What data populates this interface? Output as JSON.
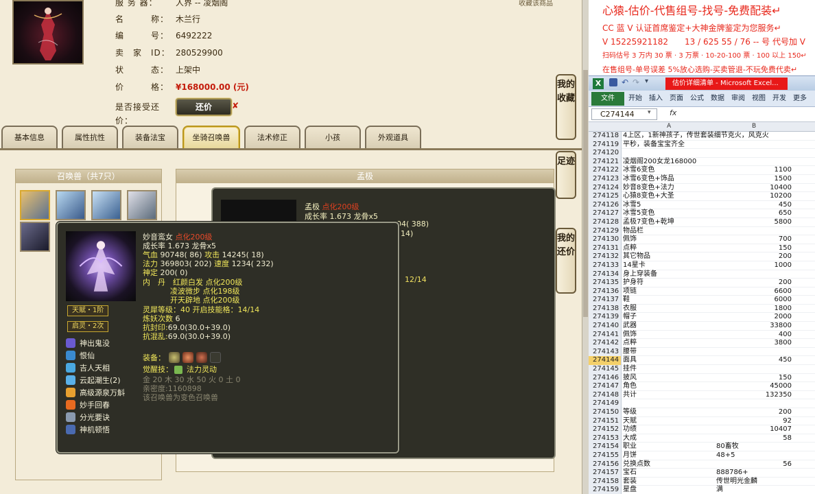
{
  "listing": {
    "server_label": "服 务 器：",
    "server_value": "人界 -- 凌烟阁",
    "name_label": "名　　　称：",
    "name_value": "木兰行",
    "id_label": "编　　　号：",
    "id_value": "6492222",
    "seller_label": "卖　家　ID：",
    "seller_value": "280529900",
    "status_label": "状　　　态：",
    "status_value": "上架中",
    "price_label": "价　　　格：",
    "price_value": "¥168000.00 (元)",
    "counter_label": "是否接受还价：",
    "counter_button": "还价",
    "counter_mark": "✘",
    "fav_link": "收藏该商品"
  },
  "tabs": [
    "基本信息",
    "属性抗性",
    "装备法宝",
    "坐骑召唤兽",
    "法术修正",
    "小孩",
    "外观道具"
  ],
  "active_tab": "坐骑召唤兽",
  "side_buttons": [
    {
      "label": "我的收藏"
    },
    {
      "label": "足迹"
    },
    {
      "label": "我的还价"
    }
  ],
  "pets_panel": {
    "title": "召唤兽（共7只）"
  },
  "detail_panel": {
    "title": "孟极"
  },
  "back_tooltip": {
    "name": "孟极",
    "tag": "点化200级",
    "growth": "成长率 1.673 龙骨x5",
    "frag1": "04( 388)",
    "frag2": "14)",
    "frag3": "12/14"
  },
  "tooltip": {
    "name": "妙音鸾女",
    "tag": "点化200级",
    "growth": "成长率 1.673 龙骨x5",
    "hp_label": "气血",
    "hp": "90748( 86)",
    "atk_label": "攻击",
    "atk": "14245( 18)",
    "mp_label": "法力",
    "mp": "369803( 202)",
    "spd_label": "速度",
    "spd": "1234( 232)",
    "def_label": "神定",
    "def": "200( 0)",
    "neidan_label": "内　丹",
    "neidan1": "红颜白发 点化200级",
    "neidan2": "凌波微步 点化198级",
    "neidan3": "开天辟地 点化200级",
    "talent_badge": "天赋・1阶",
    "qiling_badge": "启灵・2次",
    "lingxi_label": "灵犀等级：",
    "lingxi_value": "40 开启技能格：14/14",
    "refine_label": "炼妖次数",
    "refine_value": "6",
    "resist_seal_label": "抗封印:",
    "resist_seal_value": "69.0(30.0+39.0)",
    "resist_chaos_label": "抗混乱:",
    "resist_chaos_value": "69.0(30.0+39.0)",
    "equip_label": "装备：",
    "awaken_label": "觉醒技：",
    "awaken_value": "法力灵动",
    "elements": "金 20 木 30 水 50 火 0 土 0",
    "intimacy": "亲密度:1160898",
    "note": "该召唤兽为变色召唤兽",
    "skills": [
      "神出鬼没",
      "恨仙",
      "吉人天相",
      "云起潮生(2)",
      "高级源泉万斛",
      "妙手回春",
      "分光要诀",
      "神机顿悟"
    ]
  },
  "ad": {
    "line1": "心猿-估价-代售组号-找号-免费配装↵",
    "line2": "CC 蓝 V 认证首席鉴定+大神金牌鉴定为您服务↵",
    "line3": "V 15225921182　　13 / 625 55 / 76 -- 号 代号加 V",
    "line4": "扫码估号 3 万内 30 票 · 3 万票 · 10-20-100 票 · 100 以上 150↵",
    "line5": "在售组号-单号误差 5%放心选购-买卖管退-不玩免费代卖↵"
  },
  "excel": {
    "title": "估价详细清单 - Microsoft Excel...",
    "ribbon_tabs": [
      "文件",
      "开始",
      "插入",
      "页面",
      "公式",
      "数据",
      "审阅",
      "视图",
      "开发",
      "更多"
    ],
    "namebox": "C274144",
    "fx": "fx",
    "col_a": "A",
    "col_b": "B",
    "rows": [
      {
        "n": "274118",
        "a": "4上区，1新神孩子，传世套装细节克火，风克火",
        "b": ""
      },
      {
        "n": "274119",
        "a": "平秒，装备宝宝齐全",
        "b": ""
      },
      {
        "n": "274120",
        "a": "",
        "b": ""
      },
      {
        "n": "274121",
        "a": "凌烟阁200女龙168000",
        "b": ""
      },
      {
        "n": "274122",
        "a": "冰雪6变色",
        "b": "1100"
      },
      {
        "n": "274123",
        "a": "冰雪6变色+饰品",
        "b": "1500"
      },
      {
        "n": "274124",
        "a": "妙音8变色+法力",
        "b": "10400"
      },
      {
        "n": "274125",
        "a": "心猿8变色+大圣",
        "b": "10200"
      },
      {
        "n": "274126",
        "a": "冰雪5",
        "b": "450"
      },
      {
        "n": "274127",
        "a": "冰雪5变色",
        "b": "650"
      },
      {
        "n": "274128",
        "a": "孟极7变色+乾坤",
        "b": "5800"
      },
      {
        "n": "274129",
        "a": "物品栏",
        "b": ""
      },
      {
        "n": "274130",
        "a": "佩饰",
        "b": "700"
      },
      {
        "n": "274131",
        "a": "点粹",
        "b": "150"
      },
      {
        "n": "274132",
        "a": "其它物品",
        "b": "200"
      },
      {
        "n": "274133",
        "a": "14星卡",
        "b": "1000"
      },
      {
        "n": "274134",
        "a": "身上穿装备",
        "b": ""
      },
      {
        "n": "274135",
        "a": "护身符",
        "b": "200"
      },
      {
        "n": "274136",
        "a": "项链",
        "b": "6600"
      },
      {
        "n": "274137",
        "a": "鞋",
        "b": "6000"
      },
      {
        "n": "274138",
        "a": "衣服",
        "b": "1800"
      },
      {
        "n": "274139",
        "a": "帽子",
        "b": "2000"
      },
      {
        "n": "274140",
        "a": "武器",
        "b": "33800"
      },
      {
        "n": "274141",
        "a": "佩饰",
        "b": "400"
      },
      {
        "n": "274142",
        "a": "点粹",
        "b": "3800"
      },
      {
        "n": "274143",
        "a": "腰带",
        "b": ""
      },
      {
        "n": "274144",
        "a": "面具",
        "b": "450"
      },
      {
        "n": "274145",
        "a": "挂件",
        "b": ""
      },
      {
        "n": "274146",
        "a": "披风",
        "b": "150"
      },
      {
        "n": "274147",
        "a": "角色",
        "b": "45000"
      },
      {
        "n": "274148",
        "a": "共计",
        "b": "132350"
      },
      {
        "n": "274149",
        "a": "",
        "b": ""
      },
      {
        "n": "274150",
        "a": "等级",
        "b": "200"
      },
      {
        "n": "274151",
        "a": "天赋",
        "b": "92"
      },
      {
        "n": "274152",
        "a": "功绩",
        "b": "10407"
      },
      {
        "n": "274153",
        "a": "大成",
        "b": "58"
      },
      {
        "n": "274154",
        "a": "职业",
        "b": "80畜牧",
        "left": true
      },
      {
        "n": "274155",
        "a": "月饼",
        "b": "48+5",
        "left": true
      },
      {
        "n": "274156",
        "a": "兑换点数",
        "b": "56"
      },
      {
        "n": "274157",
        "a": "宝石",
        "b": "888786+",
        "left": true
      },
      {
        "n": "274158",
        "a": "套装",
        "b": "传世明光金麟",
        "left": true
      },
      {
        "n": "274159",
        "a": "星盘",
        "b": "满",
        "left": true
      }
    ]
  }
}
